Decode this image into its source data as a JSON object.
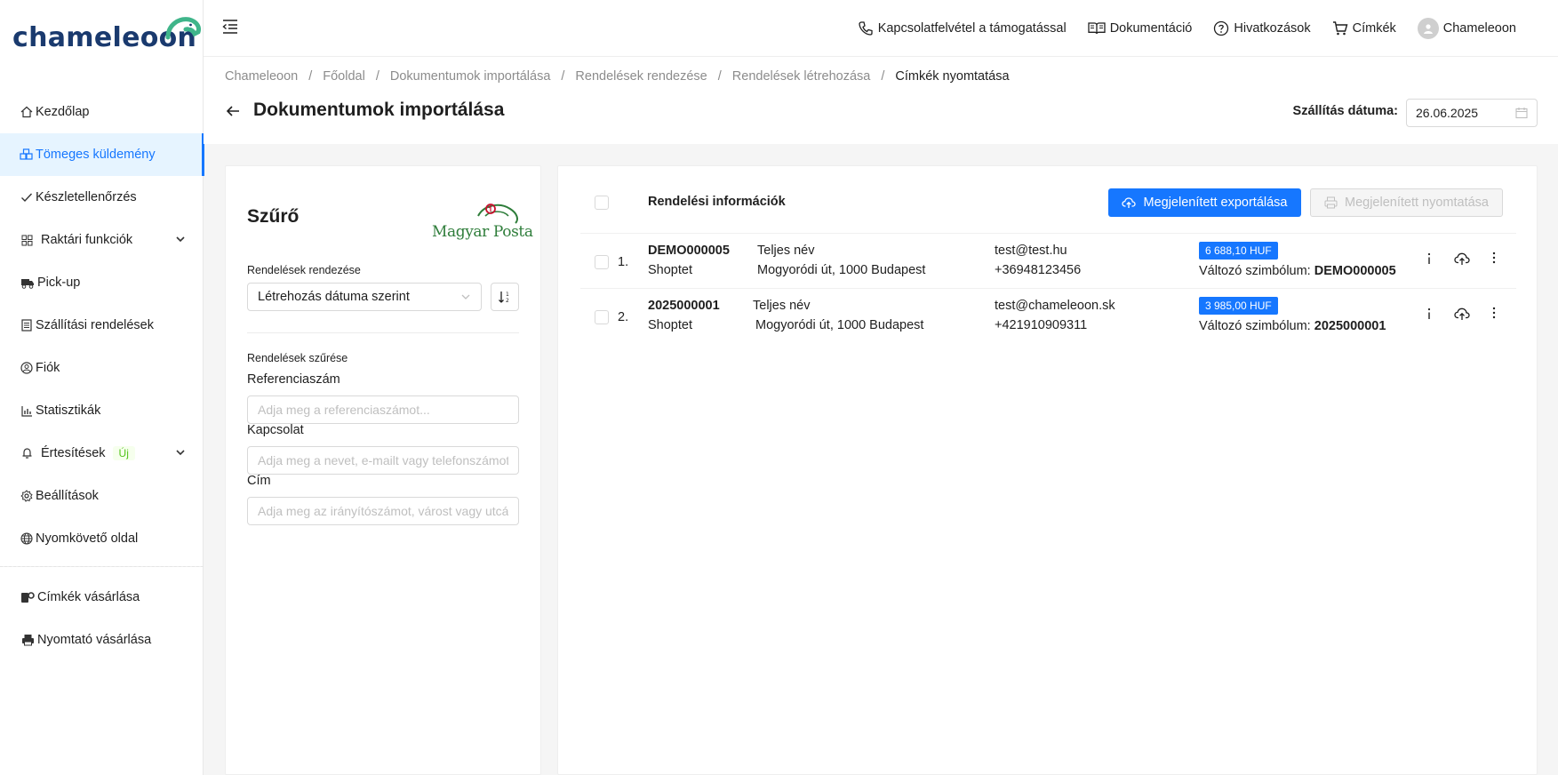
{
  "brand": {
    "logo_text": "chameleoon"
  },
  "sidebar": {
    "items": [
      {
        "label": "Kezdőlap",
        "icon": "home-icon"
      },
      {
        "label": "Tömeges küldemény",
        "icon": "boxes-icon",
        "active": true
      },
      {
        "label": "Készletellenőrzés",
        "icon": "check-icon"
      },
      {
        "label": "Raktári funkciók",
        "icon": "grid-icon"
      },
      {
        "label": "Pick-up",
        "icon": "truck-icon"
      },
      {
        "label": "Szállítási rendelések",
        "icon": "document-icon"
      },
      {
        "label": "Fiók",
        "icon": "user-circle-icon"
      },
      {
        "label": "Statisztikák",
        "icon": "bar-chart-icon"
      },
      {
        "label": "Értesítések",
        "icon": "bell-icon",
        "badge": "Új"
      },
      {
        "label": "Beállítások",
        "icon": "gear-icon"
      },
      {
        "label": "Nyomkövető oldal",
        "icon": "globe-icon"
      }
    ],
    "bottom_items": [
      {
        "label": "Címkék vásárlása",
        "icon": "label-roll-icon"
      },
      {
        "label": "Nyomtató vásárlása",
        "icon": "printer-icon"
      }
    ]
  },
  "topbar": {
    "support": "Kapcsolatfelvétel a támogatással",
    "docs": "Dokumentáció",
    "references": "Hivatkozások",
    "labels": "Címkék",
    "user": "Chameleoon"
  },
  "breadcrumb": [
    "Chameleoon",
    "Főoldal",
    "Dokumentumok importálása",
    "Rendelések rendezése",
    "Rendelések létrehozása",
    "Címkék nyomtatása"
  ],
  "page": {
    "title": "Dokumentumok importálása",
    "date_label": "Szállítás dátuma:",
    "date_value": "26.06.2025"
  },
  "filter": {
    "title": "Szűrő",
    "carrier_logo_text": "Magyar Posta",
    "sort_label": "Rendelések rendezése",
    "sort_value": "Létrehozás dátuma szerint",
    "filter_section": "Rendelések szűrése",
    "ref_label": "Referenciaszám",
    "ref_placeholder": "Adja meg a referenciaszámot...",
    "contact_label": "Kapcsolat",
    "contact_placeholder": "Adja meg a nevet, e-mailt vagy telefonszámot...",
    "address_label": "Cím",
    "address_placeholder": "Adja meg az irányítószámot, várost vagy utcát..."
  },
  "orders": {
    "header": "Rendelési információk",
    "export_button": "Megjelenített exportálása",
    "print_button": "Megjelenített nyomtatása",
    "rows": [
      {
        "index": "1.",
        "number": "DEMO000005",
        "source": "Shoptet",
        "name": "Teljes név",
        "address": "Mogyoródi út, 1000 Budapest",
        "email": "test@test.hu",
        "phone": "+36948123456",
        "price": "6 688,10 HUF",
        "vs_label": "Változó szimbólum:",
        "vs_value": "DEMO000005"
      },
      {
        "index": "2.",
        "number": "2025000001",
        "source": "Shoptet",
        "name": "Teljes név",
        "address": "Mogyoródi út, 1000 Budapest",
        "email": "test@chameleoon.sk",
        "phone": "+421910909311",
        "price": "3 985,00 HUF",
        "vs_label": "Változó szimbólum:",
        "vs_value": "2025000001"
      }
    ]
  },
  "colors": {
    "accent": "#1677ff",
    "brand_green": "#3fb58a",
    "brand_navy": "#1a3a6e",
    "badge_green": "#52c41a"
  }
}
